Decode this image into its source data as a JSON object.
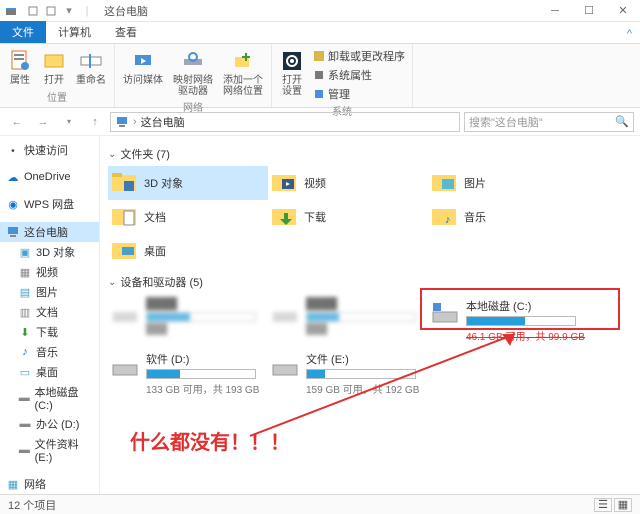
{
  "window": {
    "title": "这台电脑"
  },
  "tabs": {
    "file": "文件",
    "computer": "计算机",
    "view": "查看"
  },
  "ribbon": {
    "properties": "属性",
    "open": "打开",
    "rename": "重命名",
    "media": "访问媒体",
    "mapdrive": "映射网络\n驱动器",
    "addnet": "添加一个\n网络位置",
    "opensettings": "打开\n设置",
    "uninstall": "卸载或更改程序",
    "sysprops": "系统属性",
    "manage": "管理",
    "g_location": "位置",
    "g_network": "网络",
    "g_system": "系统"
  },
  "nav": {
    "path": "这台电脑",
    "search_ph": "搜索\"这台电脑\""
  },
  "sidebar": {
    "quick": "快速访问",
    "onedrive": "OneDrive",
    "wps": "WPS 网盘",
    "thispc": "这台电脑",
    "obj3d": "3D 对象",
    "videos": "视频",
    "pictures": "图片",
    "docs": "文档",
    "downloads": "下载",
    "music": "音乐",
    "desktop": "桌面",
    "disk_c": "本地磁盘 (C:)",
    "office_d": "办公 (D:)",
    "files_e": "文件资料 (E:)",
    "network": "网络"
  },
  "content": {
    "folders_hdr": "文件夹 (7)",
    "folders": {
      "obj3d": "3D 对象",
      "videos": "视频",
      "pictures": "图片",
      "docs": "文档",
      "downloads": "下载",
      "music": "音乐",
      "desktop": "桌面"
    },
    "drives_hdr": "设备和驱动器 (5)",
    "drives": {
      "c": {
        "name": "本地磁盘 (C:)",
        "sub": "46.1 GB 可用，共 99.9 GB",
        "pct": 54
      },
      "d": {
        "name": "软件 (D:)",
        "sub": "133 GB 可用，共 193 GB",
        "pct": 31
      },
      "e": {
        "name": "文件 (E:)",
        "sub": "159 GB 可用，共 192 GB",
        "pct": 17
      }
    }
  },
  "annotation": "什么都没有！！！",
  "status": {
    "items": "12 个项目"
  }
}
